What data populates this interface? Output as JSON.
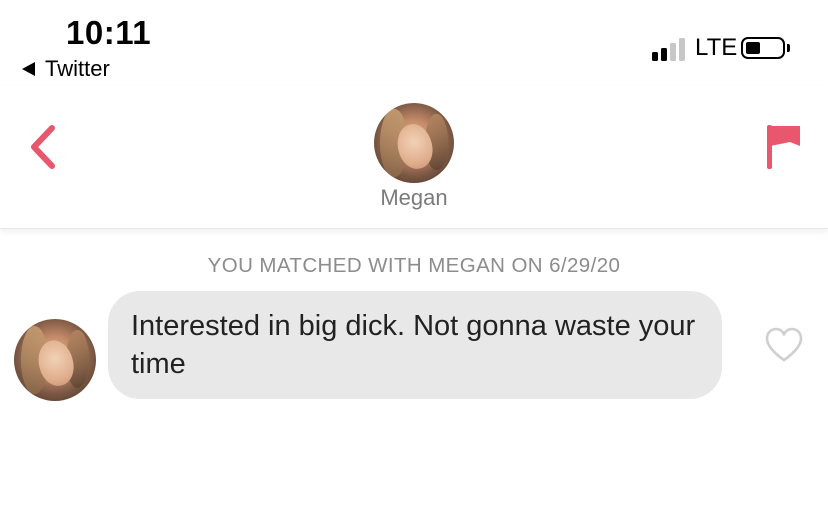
{
  "status_bar": {
    "time": "10:11",
    "back_app": "Twitter",
    "network": "LTE",
    "signal_bars_filled": 2,
    "signal_bars_total": 4,
    "battery_level": 0.4
  },
  "header": {
    "back_icon": "chevron-left-icon",
    "report_icon": "flag-icon",
    "match_name": "Megan"
  },
  "chat": {
    "match_notice": "YOU MATCHED WITH MEGAN ON 6/29/20",
    "messages": [
      {
        "text": "Interested in big dick. Not gonna waste your time",
        "sender": "Megan",
        "like_icon": "heart-outline-icon"
      }
    ]
  },
  "colors": {
    "accent": "#e8576d",
    "bubble": "#e8e8e8",
    "muted_text": "#8c8c8c",
    "heart_outline": "#cfcfcf"
  }
}
